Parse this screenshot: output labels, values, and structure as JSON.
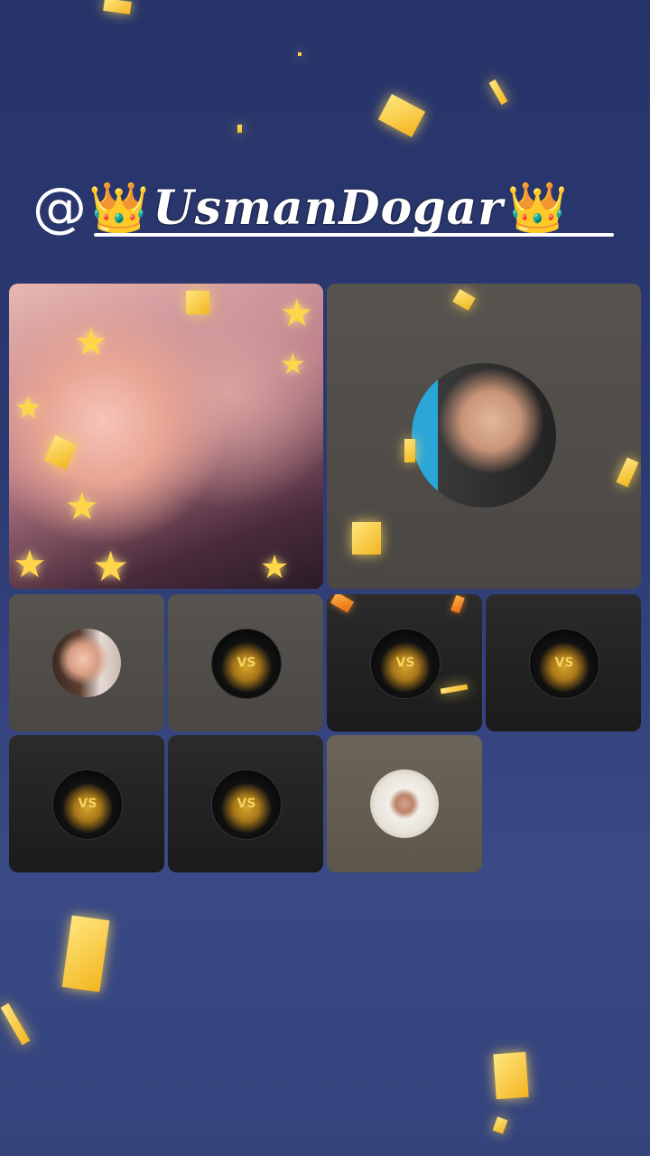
{
  "banner": {
    "at": "@",
    "crown_left": "👑",
    "name": "UsmanDogar",
    "crown_right": "👑"
  },
  "colors": {
    "background": "#2c3a72",
    "confetti": "#f3c12a",
    "tile_gray": "#524e4a",
    "tile_dark": "#222222"
  },
  "seats": [
    {
      "role": "host",
      "icon": "portrait-photo"
    },
    {
      "role": "guest",
      "icon": "guest-avatar"
    },
    {
      "role": "guest",
      "icon": "girl-avatar"
    },
    {
      "role": "guest",
      "icon": "vs-poster-avatar"
    },
    {
      "role": "guest",
      "icon": "vs-poster-avatar"
    },
    {
      "role": "guest",
      "icon": "vs-poster-avatar"
    },
    {
      "role": "guest",
      "icon": "vs-poster-avatar"
    },
    {
      "role": "guest",
      "icon": "vs-poster-avatar"
    },
    {
      "role": "guest",
      "icon": "hijab-avatar"
    }
  ]
}
